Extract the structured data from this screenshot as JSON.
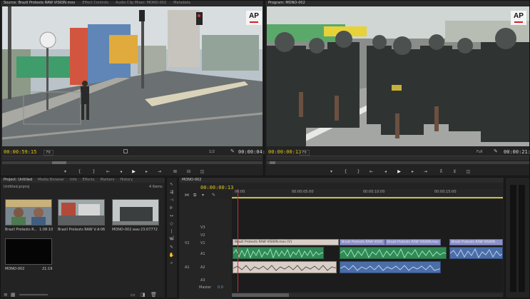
{
  "source_monitor": {
    "tab_label": "Source: Brazil Protests RAW VISION.mov",
    "other_tabs": [
      "Effect Controls",
      "Audio Clip Mixer: MONO-002",
      "Metadata"
    ],
    "timecode_current": "00:00:59:15",
    "fit_label": "Fit",
    "resolution_label": "1/2",
    "timecode_duration": "00:00:04:06"
  },
  "program_monitor": {
    "tab_label": "Program: MONO-002",
    "timecode_current": "00:00:00:13",
    "fit_label": "Fit",
    "resolution_label": "Full",
    "timecode_duration": "00:00:21:19"
  },
  "watermark": "AP",
  "project_panel": {
    "tabs": [
      "Project: Untitled",
      "Media Browser",
      "Info",
      "Effects",
      "Markers",
      "History"
    ],
    "project_file": "Untitled.prproj",
    "item_count": "4 Items",
    "items": [
      {
        "name": "Brazil Protests R...",
        "duration": "1:08:10"
      },
      {
        "name": "Brazil Protests RAW V...",
        "duration": "4:06"
      },
      {
        "name": "MONO-002.wav",
        "duration": "23:07772"
      },
      {
        "name": "MONO-002",
        "duration": "21:19"
      }
    ]
  },
  "timeline": {
    "tab_label": "MONO-002",
    "timecode": "00:00:00:13",
    "ruler_labels": [
      "00:00",
      "00:00:05:00",
      "00:00:10:00",
      "00:00:15:00"
    ],
    "tracks": {
      "v3": "V3",
      "v2": "V2",
      "v1": "V1",
      "a1": "A1",
      "a2": "A2",
      "a3": "A3",
      "source_v": "V1",
      "source_a": "A1",
      "master": "Master",
      "master_value": "0.0"
    },
    "clips": {
      "v1_main": "Brazil Protests RAW VISION.mov [V]",
      "v1_second": "Brazil Protests RAW VISIO",
      "v1_third": "Brazil Protests RAW VISION.mov",
      "v1_fourth": "Brazil Protests RAW VISION"
    }
  },
  "colors": {
    "timecode": "#e6c619",
    "video_clip": "#d9cfc7",
    "video_clip_2": "#8d92c8",
    "audio_clip": "#2f8a56",
    "audio_clip_2": "#4b6ea8",
    "playhead": "#d0303a"
  }
}
